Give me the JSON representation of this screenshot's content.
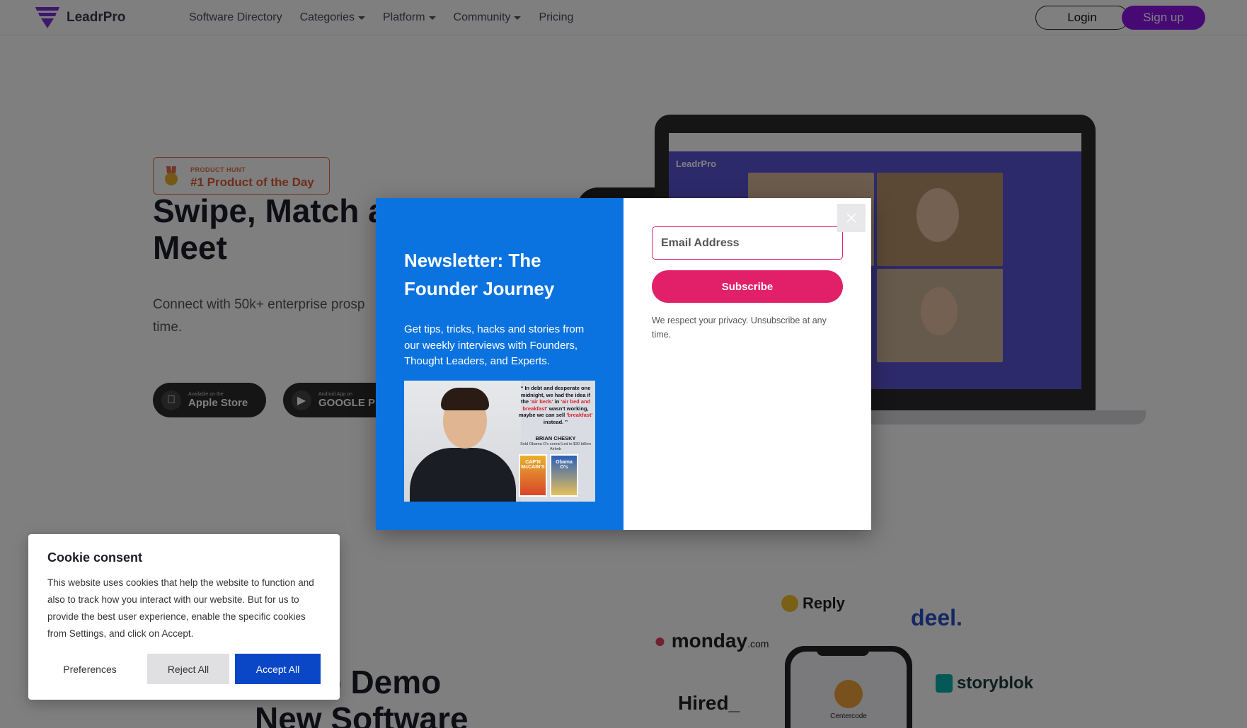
{
  "nav": {
    "brand": "LeadrPro",
    "links": [
      "Software Directory",
      "Categories",
      "Platform",
      "Community",
      "Pricing"
    ],
    "login": "Login",
    "signup": "Sign up"
  },
  "hero": {
    "badge_small": "PRODUCT HUNT",
    "badge_big": "#1 Product of the Day",
    "title_line1": "Swipe, Match a",
    "title_line2": "Meet",
    "subtitle_line1": "Connect with 50k+ enterprise prosp",
    "subtitle_line2": "time.",
    "apple_small": "Available on the",
    "apple_big": "Apple Store",
    "google_small": "Android App on",
    "google_big": "GOOGLE PL"
  },
  "laptop": {
    "app_brand": "LeadrPro"
  },
  "lower": {
    "title_line1": "aid to Demo",
    "title_line2": "New Software",
    "brands": [
      "Reply",
      "deel.",
      "monday",
      ".com",
      "Hired_",
      "storyblok"
    ],
    "phone_app": "Centercode"
  },
  "modal": {
    "title": "Newsletter: The Founder Journey",
    "description": "Get tips, tricks, hacks and stories from our weekly interviews with Founders, Thought Leaders, and Experts.",
    "quote_part1": "In debt and desperate one midnight, we had the idea if the",
    "quote_red1": "'air beds'",
    "quote_part2": "in",
    "quote_red2": "'air bed and breakfast'",
    "quote_part3": "wasn't working, maybe we can sell",
    "quote_red3": "'breakfast'",
    "quote_part4": "instead.",
    "quote_name": "BRIAN CHESKY",
    "quote_sub": "Sold Obama O's cereal Led to $30 billion Airbnb",
    "cereal1": "CAP'N McCAIN'S",
    "cereal2": "Obama O's",
    "email_placeholder": "Email Address",
    "subscribe": "Subscribe",
    "privacy": "We respect your privacy. Unsubscribe at any time."
  },
  "cookie": {
    "title": "Cookie consent",
    "text": "This website uses cookies that help the website to function and also to track how you interact with our website. But for us to provide the best user experience, enable the specific cookies from Settings, and click on Accept.",
    "preferences": "Preferences",
    "reject": "Reject All",
    "accept": "Accept All"
  },
  "colors": {
    "brand_purple": "#8e14e8",
    "modal_blue": "#0b73e0",
    "subscribe_pink": "#e2206a",
    "accept_blue": "#0a47c7"
  }
}
